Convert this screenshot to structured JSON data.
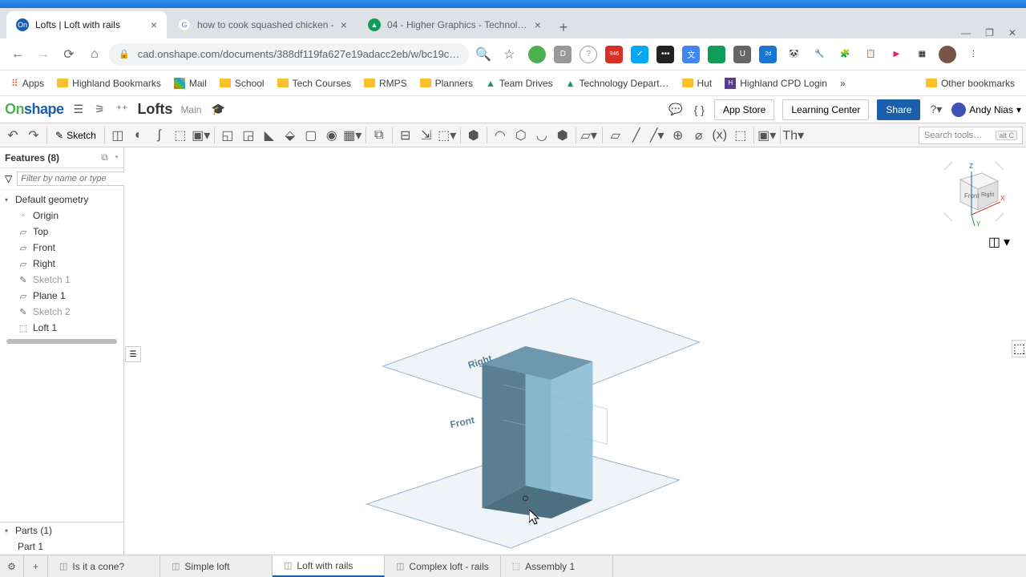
{
  "browser": {
    "tabs": [
      {
        "title": "Lofts | Loft with rails",
        "active": true,
        "favicon_bg": "#1b5faa",
        "favicon_text": "On",
        "favicon_color": "#fff"
      },
      {
        "title": "how to cook squashed chicken -",
        "active": false,
        "favicon_bg": "#fff",
        "favicon_text": "G",
        "favicon_color": "#4285f4"
      },
      {
        "title": "04 - Higher Graphics - Technolog",
        "active": false,
        "favicon_bg": "#0f9d58",
        "favicon_text": "▲",
        "favicon_color": "#fff"
      }
    ],
    "url": "cad.onshape.com/documents/388df119fa627e19adacc2eb/w/bc19c…"
  },
  "bookmarks": {
    "apps": "Apps",
    "items": [
      "Highland Bookmarks",
      "Mail",
      "School",
      "Tech Courses",
      "RMPS",
      "Planners",
      "Team Drives",
      "Technology Depart…",
      "Hut",
      "Highland CPD  Login"
    ],
    "other": "Other bookmarks"
  },
  "header": {
    "doc_name": "Lofts",
    "branch": "Main",
    "app_store": "App Store",
    "learning_center": "Learning Center",
    "share": "Share",
    "user": "Andy Nias"
  },
  "toolbar": {
    "sketch": "Sketch",
    "search_placeholder": "Search tools…",
    "search_kbd": "alt C"
  },
  "features": {
    "title": "Features (8)",
    "filter_placeholder": "Filter by name or type",
    "default_geometry": "Default geometry",
    "items": [
      "Origin",
      "Top",
      "Front",
      "Right"
    ],
    "user_features": [
      "Sketch 1",
      "Plane 1",
      "Sketch 2",
      "Loft 1"
    ]
  },
  "parts": {
    "title": "Parts (1)",
    "items": [
      "Part 1"
    ]
  },
  "canvas": {
    "label_right": "Right",
    "label_front": "Front",
    "cube_front": "Front",
    "cube_right": "Right"
  },
  "bottom_tabs": {
    "tabs": [
      {
        "label": "Is it a cone?",
        "active": false
      },
      {
        "label": "Simple loft",
        "active": false
      },
      {
        "label": "Loft with rails",
        "active": true
      },
      {
        "label": "Complex loft - rails",
        "active": false
      },
      {
        "label": "Assembly 1",
        "active": false
      }
    ]
  }
}
